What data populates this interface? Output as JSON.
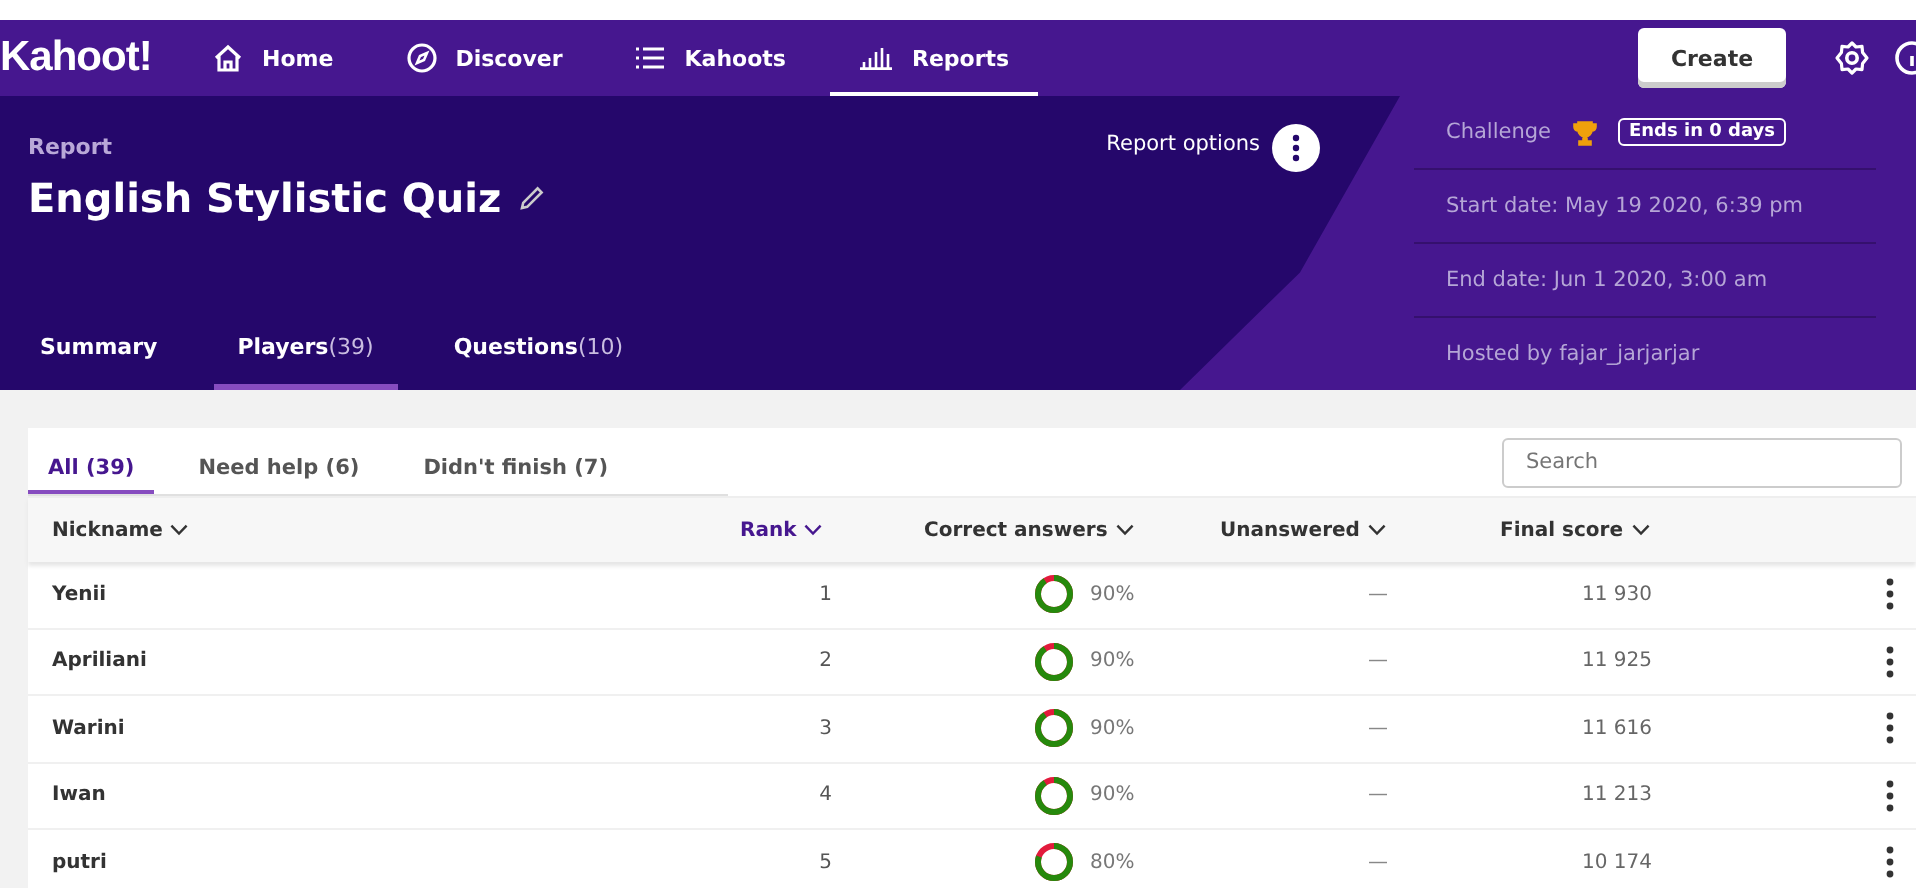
{
  "logo": "Kahoot!",
  "nav": [
    {
      "label": "Home",
      "selected": false
    },
    {
      "label": "Discover",
      "selected": false
    },
    {
      "label": "Kahoots",
      "selected": false
    },
    {
      "label": "Reports",
      "selected": true
    }
  ],
  "create_button": "Create",
  "report": {
    "eyebrow": "Report",
    "title": "English Stylistic Quiz",
    "options_label": "Report options"
  },
  "report_tabs": [
    {
      "label": "Summary",
      "selected": false
    },
    {
      "label": "Players",
      "count": "(39)",
      "selected": true
    },
    {
      "label": "Questions",
      "count": "(10)",
      "selected": false
    }
  ],
  "info": {
    "challenge": "Challenge",
    "badge": "Ends in 0 days",
    "start": "Start date: May 19 2020, 6:39 pm",
    "end": "End date: Jun 1 2020, 3:00 am",
    "host": "Hosted by fajar_jarjarjar"
  },
  "filter_tabs": [
    {
      "label": "All (39)",
      "selected": true
    },
    {
      "label": "Need help (6)",
      "selected": false
    },
    {
      "label": "Didn't finish (7)",
      "selected": false
    }
  ],
  "search": {
    "placeholder": "Search"
  },
  "columns": [
    {
      "label": "Nickname",
      "selected": false
    },
    {
      "label": "Rank",
      "selected": true
    },
    {
      "label": "Correct answers",
      "selected": false
    },
    {
      "label": "Unanswered",
      "selected": false
    },
    {
      "label": "Final score",
      "selected": false
    }
  ],
  "rows": [
    {
      "nickname": "Yenii",
      "rank": "1",
      "level": 0.9,
      "correct": "90%",
      "unanswered": "—",
      "score": "11 930"
    },
    {
      "nickname": "Apriliani",
      "rank": "2",
      "level": 0.9,
      "correct": "90%",
      "unanswered": "—",
      "score": "11 925"
    },
    {
      "nickname": "Warini",
      "rank": "3",
      "level": 0.9,
      "correct": "90%",
      "unanswered": "—",
      "score": "11 616"
    },
    {
      "nickname": "Iwan",
      "rank": "4",
      "level": 0.9,
      "correct": "90%",
      "unanswered": "—",
      "score": "11 213"
    },
    {
      "nickname": "putri",
      "rank": "5",
      "level": 0.8,
      "correct": "80%",
      "unanswered": "—",
      "score": "10 174"
    }
  ]
}
